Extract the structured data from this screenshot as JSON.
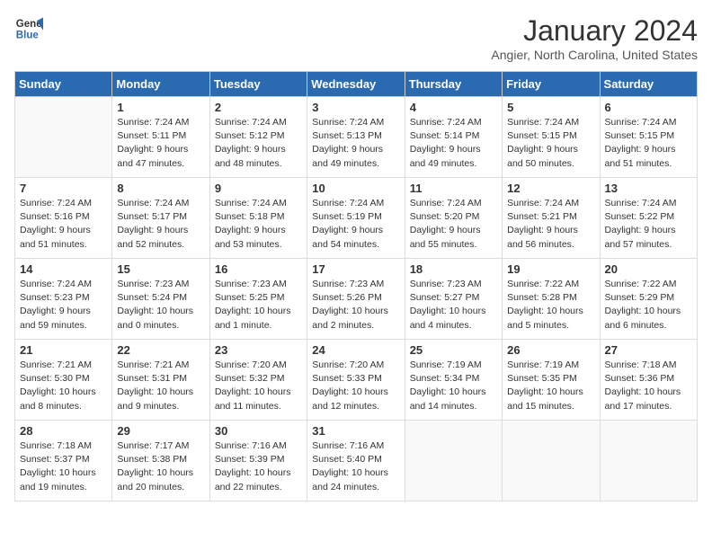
{
  "header": {
    "logo_line1": "General",
    "logo_line2": "Blue",
    "month": "January 2024",
    "location": "Angier, North Carolina, United States"
  },
  "days_of_week": [
    "Sunday",
    "Monday",
    "Tuesday",
    "Wednesday",
    "Thursday",
    "Friday",
    "Saturday"
  ],
  "weeks": [
    [
      {
        "day": "",
        "info": ""
      },
      {
        "day": "1",
        "info": "Sunrise: 7:24 AM\nSunset: 5:11 PM\nDaylight: 9 hours\nand 47 minutes."
      },
      {
        "day": "2",
        "info": "Sunrise: 7:24 AM\nSunset: 5:12 PM\nDaylight: 9 hours\nand 48 minutes."
      },
      {
        "day": "3",
        "info": "Sunrise: 7:24 AM\nSunset: 5:13 PM\nDaylight: 9 hours\nand 49 minutes."
      },
      {
        "day": "4",
        "info": "Sunrise: 7:24 AM\nSunset: 5:14 PM\nDaylight: 9 hours\nand 49 minutes."
      },
      {
        "day": "5",
        "info": "Sunrise: 7:24 AM\nSunset: 5:15 PM\nDaylight: 9 hours\nand 50 minutes."
      },
      {
        "day": "6",
        "info": "Sunrise: 7:24 AM\nSunset: 5:15 PM\nDaylight: 9 hours\nand 51 minutes."
      }
    ],
    [
      {
        "day": "7",
        "info": "Sunrise: 7:24 AM\nSunset: 5:16 PM\nDaylight: 9 hours\nand 51 minutes."
      },
      {
        "day": "8",
        "info": "Sunrise: 7:24 AM\nSunset: 5:17 PM\nDaylight: 9 hours\nand 52 minutes."
      },
      {
        "day": "9",
        "info": "Sunrise: 7:24 AM\nSunset: 5:18 PM\nDaylight: 9 hours\nand 53 minutes."
      },
      {
        "day": "10",
        "info": "Sunrise: 7:24 AM\nSunset: 5:19 PM\nDaylight: 9 hours\nand 54 minutes."
      },
      {
        "day": "11",
        "info": "Sunrise: 7:24 AM\nSunset: 5:20 PM\nDaylight: 9 hours\nand 55 minutes."
      },
      {
        "day": "12",
        "info": "Sunrise: 7:24 AM\nSunset: 5:21 PM\nDaylight: 9 hours\nand 56 minutes."
      },
      {
        "day": "13",
        "info": "Sunrise: 7:24 AM\nSunset: 5:22 PM\nDaylight: 9 hours\nand 57 minutes."
      }
    ],
    [
      {
        "day": "14",
        "info": "Sunrise: 7:24 AM\nSunset: 5:23 PM\nDaylight: 9 hours\nand 59 minutes."
      },
      {
        "day": "15",
        "info": "Sunrise: 7:23 AM\nSunset: 5:24 PM\nDaylight: 10 hours\nand 0 minutes."
      },
      {
        "day": "16",
        "info": "Sunrise: 7:23 AM\nSunset: 5:25 PM\nDaylight: 10 hours\nand 1 minute."
      },
      {
        "day": "17",
        "info": "Sunrise: 7:23 AM\nSunset: 5:26 PM\nDaylight: 10 hours\nand 2 minutes."
      },
      {
        "day": "18",
        "info": "Sunrise: 7:23 AM\nSunset: 5:27 PM\nDaylight: 10 hours\nand 4 minutes."
      },
      {
        "day": "19",
        "info": "Sunrise: 7:22 AM\nSunset: 5:28 PM\nDaylight: 10 hours\nand 5 minutes."
      },
      {
        "day": "20",
        "info": "Sunrise: 7:22 AM\nSunset: 5:29 PM\nDaylight: 10 hours\nand 6 minutes."
      }
    ],
    [
      {
        "day": "21",
        "info": "Sunrise: 7:21 AM\nSunset: 5:30 PM\nDaylight: 10 hours\nand 8 minutes."
      },
      {
        "day": "22",
        "info": "Sunrise: 7:21 AM\nSunset: 5:31 PM\nDaylight: 10 hours\nand 9 minutes."
      },
      {
        "day": "23",
        "info": "Sunrise: 7:20 AM\nSunset: 5:32 PM\nDaylight: 10 hours\nand 11 minutes."
      },
      {
        "day": "24",
        "info": "Sunrise: 7:20 AM\nSunset: 5:33 PM\nDaylight: 10 hours\nand 12 minutes."
      },
      {
        "day": "25",
        "info": "Sunrise: 7:19 AM\nSunset: 5:34 PM\nDaylight: 10 hours\nand 14 minutes."
      },
      {
        "day": "26",
        "info": "Sunrise: 7:19 AM\nSunset: 5:35 PM\nDaylight: 10 hours\nand 15 minutes."
      },
      {
        "day": "27",
        "info": "Sunrise: 7:18 AM\nSunset: 5:36 PM\nDaylight: 10 hours\nand 17 minutes."
      }
    ],
    [
      {
        "day": "28",
        "info": "Sunrise: 7:18 AM\nSunset: 5:37 PM\nDaylight: 10 hours\nand 19 minutes."
      },
      {
        "day": "29",
        "info": "Sunrise: 7:17 AM\nSunset: 5:38 PM\nDaylight: 10 hours\nand 20 minutes."
      },
      {
        "day": "30",
        "info": "Sunrise: 7:16 AM\nSunset: 5:39 PM\nDaylight: 10 hours\nand 22 minutes."
      },
      {
        "day": "31",
        "info": "Sunrise: 7:16 AM\nSunset: 5:40 PM\nDaylight: 10 hours\nand 24 minutes."
      },
      {
        "day": "",
        "info": ""
      },
      {
        "day": "",
        "info": ""
      },
      {
        "day": "",
        "info": ""
      }
    ]
  ]
}
